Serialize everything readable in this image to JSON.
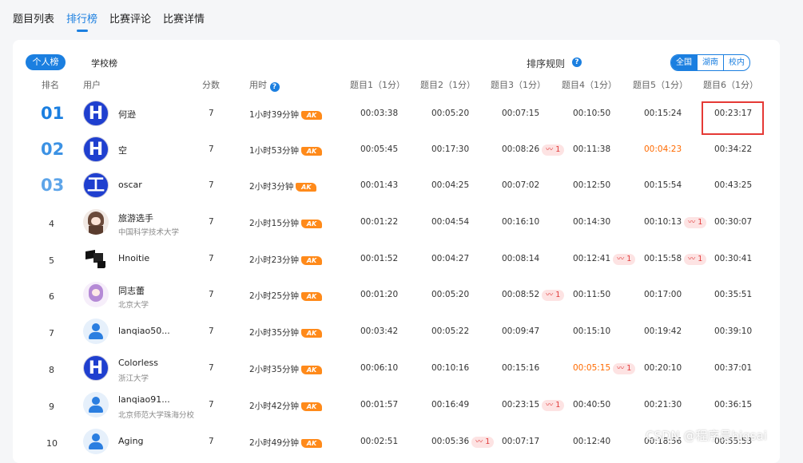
{
  "topnav": {
    "tabs": [
      {
        "label": "题目列表"
      },
      {
        "label": "排行榜"
      },
      {
        "label": "比赛评论"
      },
      {
        "label": "比赛详情"
      }
    ]
  },
  "toolbar": {
    "personal_label": "个人榜",
    "school_label": "学校榜",
    "sort_rule_label": "排序规则",
    "help_glyph": "?",
    "regions": [
      "全国",
      "湖南",
      "校内"
    ]
  },
  "table": {
    "headers": {
      "rank": "排名",
      "user": "用户",
      "score": "分数",
      "time": "用时",
      "p1": "题目1（1分）",
      "p2": "题目2（1分）",
      "p3": "题目3（1分）",
      "p4": "题目4（1分）",
      "p5": "题目5（1分）",
      "p6": "题目6（1分）"
    },
    "ak_label": "AK",
    "rows": [
      {
        "rank": "01",
        "avatar": "H",
        "name": "何逊",
        "school": "",
        "score": "7",
        "time": "1小时39分钟",
        "p1": "00:03:38",
        "p2": "00:05:20",
        "p3": "00:07:15",
        "p4": "00:10:50",
        "p5": "00:15:24",
        "p6": "00:23:17",
        "w3": "",
        "w4": "",
        "w5": "",
        "w6": "",
        "w2": ""
      },
      {
        "rank": "02",
        "avatar": "H",
        "name": "空",
        "school": "",
        "score": "7",
        "time": "1小时53分钟",
        "p1": "00:05:45",
        "p2": "00:17:30",
        "p3": "00:08:26",
        "p4": "00:11:38",
        "p5": "00:04:23",
        "p6": "00:34:22",
        "w2": "",
        "w3": "1",
        "w4": "",
        "w5": "",
        "w6": ""
      },
      {
        "rank": "03",
        "avatar": "工",
        "name": "oscar",
        "school": "",
        "score": "7",
        "time": "2小时3分钟",
        "p1": "00:01:43",
        "p2": "00:04:25",
        "p3": "00:07:02",
        "p4": "00:12:50",
        "p5": "00:15:54",
        "p6": "00:43:25",
        "w2": "",
        "w3": "",
        "w4": "",
        "w5": "",
        "w6": ""
      },
      {
        "rank": "4",
        "avatar": "",
        "name": "旅游选手",
        "school": "中国科学技术大学",
        "score": "7",
        "time": "2小时15分钟",
        "p1": "00:01:22",
        "p2": "00:04:54",
        "p3": "00:16:10",
        "p4": "00:14:30",
        "p5": "00:10:13",
        "p6": "00:30:07",
        "w2": "",
        "w3": "",
        "w4": "",
        "w5": "1",
        "w6": ""
      },
      {
        "rank": "5",
        "avatar": "",
        "name": "Hnoitie",
        "school": "",
        "score": "7",
        "time": "2小时23分钟",
        "p1": "00:01:52",
        "p2": "00:04:27",
        "p3": "00:08:14",
        "p4": "00:12:41",
        "p5": "00:15:58",
        "p6": "00:30:41",
        "w2": "",
        "w3": "",
        "w4": "1",
        "w5": "1",
        "w6": ""
      },
      {
        "rank": "6",
        "avatar": "",
        "name": "同志蕾",
        "school": "北京大学",
        "score": "7",
        "time": "2小时25分钟",
        "p1": "00:01:20",
        "p2": "00:05:20",
        "p3": "00:08:52",
        "p4": "00:11:50",
        "p5": "00:17:00",
        "p6": "00:35:51",
        "w2": "",
        "w3": "1",
        "w4": "",
        "w5": "",
        "w6": ""
      },
      {
        "rank": "7",
        "avatar": "",
        "name": "lanqiao50...",
        "school": "",
        "score": "7",
        "time": "2小时35分钟",
        "p1": "00:03:42",
        "p2": "00:05:22",
        "p3": "00:09:47",
        "p4": "00:15:10",
        "p5": "00:19:42",
        "p6": "00:39:10",
        "w2": "",
        "w3": "",
        "w4": "",
        "w5": "",
        "w6": ""
      },
      {
        "rank": "8",
        "avatar": "H",
        "name": "Colorless",
        "school": "浙江大学",
        "score": "7",
        "time": "2小时35分钟",
        "p1": "00:06:10",
        "p2": "00:10:16",
        "p3": "00:15:16",
        "p4": "00:05:15",
        "p5": "00:20:10",
        "p6": "00:37:01",
        "w2": "",
        "w3": "",
        "w4": "1",
        "w5": "",
        "w6": ""
      },
      {
        "rank": "9",
        "avatar": "",
        "name": "lanqiao91...",
        "school": "北京师范大学珠海分校",
        "score": "7",
        "time": "2小时42分钟",
        "p1": "00:01:57",
        "p2": "00:16:49",
        "p3": "00:23:15",
        "p4": "00:40:50",
        "p5": "00:21:30",
        "p6": "00:36:15",
        "w2": "",
        "w3": "1",
        "w4": "",
        "w5": "",
        "w6": ""
      },
      {
        "rank": "10",
        "avatar": "",
        "name": "Aging",
        "school": "",
        "score": "7",
        "time": "2小时49分钟",
        "p1": "00:02:51",
        "p2": "00:05:36",
        "p3": "00:07:17",
        "p4": "00:12:40",
        "p5": "00:18:56",
        "p6": "00:55:53",
        "w2": "1",
        "w3": "",
        "w4": "",
        "w5": "",
        "w6": ""
      }
    ]
  },
  "watermark": "CSDN @程序员bigsai",
  "colors": {
    "accent": "#1b7fe0",
    "ak": "#ff8a1a",
    "wrong_bg": "#fde3e3",
    "wrong_fg": "#e03a3a",
    "first_blood": "#ff6a00",
    "highlight": "#e53935"
  }
}
